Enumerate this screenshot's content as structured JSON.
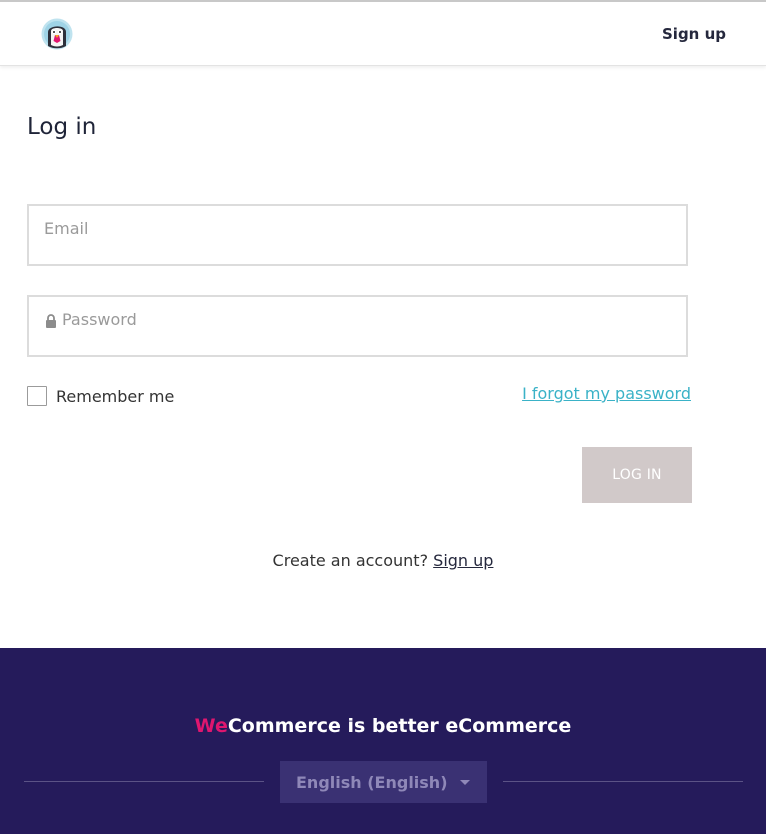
{
  "header": {
    "logo_icon": "prestashop-puffin-logo-icon",
    "signup_label": "Sign up"
  },
  "form": {
    "title": "Log in",
    "email": {
      "placeholder": "Email",
      "value": ""
    },
    "password": {
      "placeholder": "Password",
      "value": "",
      "icon": "lock-icon"
    },
    "remember_label": "Remember me",
    "remember_checked": false,
    "forgot_label": "I forgot my password",
    "login_label": "LOG IN",
    "create_prompt": "Create an account?",
    "create_link": "Sign up"
  },
  "footer": {
    "tagline_we": "We",
    "tagline_rest": "Commerce is better eCommerce",
    "language": "English (English)",
    "language_icon": "caret-down-icon"
  },
  "colors": {
    "footer_bg": "#251b5b",
    "accent_pink": "#e0166f",
    "link_teal": "#3ab2c7",
    "button_disabled": "#d1c9c9"
  }
}
